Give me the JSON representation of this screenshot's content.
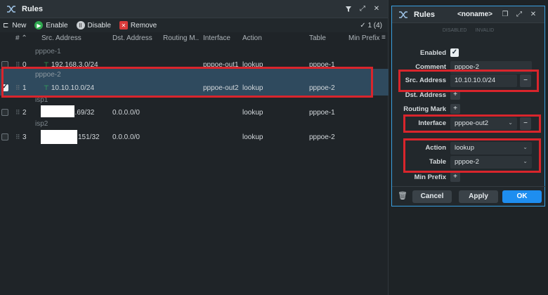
{
  "main": {
    "title": "Rules",
    "toolbar": {
      "new": "New",
      "enable": "Enable",
      "disable": "Disable",
      "remove": "Remove",
      "count": "1 (4)"
    },
    "columns": [
      "#",
      "Src. Address",
      "Dst. Address",
      "Routing M...",
      "Interface",
      "Action",
      "Table",
      "Min Prefix"
    ],
    "rows": [
      {
        "group": "pppoe-1",
        "num": "0",
        "src": "192.168.3.0/24",
        "dst": "",
        "interface": "pppoe-out1",
        "action": "lookup",
        "table": "pppoe-1",
        "selected": false
      },
      {
        "group": "pppoe-2",
        "num": "1",
        "src": "10.10.10.0/24",
        "dst": "",
        "interface": "pppoe-out2",
        "action": "lookup",
        "table": "pppoe-2",
        "selected": true
      },
      {
        "group": "isp1",
        "num": "2",
        "src": "9.69/32",
        "dst": "0.0.0.0/0",
        "interface": "",
        "action": "lookup",
        "table": "pppoe-1",
        "selected": false
      },
      {
        "group": "isp2",
        "num": "3",
        "src": "151/32",
        "dst": "0.0.0.0/0",
        "interface": "",
        "action": "lookup",
        "table": "pppoe-2",
        "selected": false
      }
    ]
  },
  "detail": {
    "title": "Rules",
    "name": "<noname>",
    "subtabs": {
      "disabled": "DISABLED",
      "invalid": "INVALID"
    },
    "labels": {
      "enabled": "Enabled",
      "comment": "Comment",
      "src": "Src. Address",
      "dst": "Dst. Address",
      "routing_mark": "Routing Mark",
      "interface": "Interface",
      "action": "Action",
      "table": "Table",
      "min_prefix": "Min Prefix"
    },
    "values": {
      "comment": "pppoe-2",
      "src": "10.10.10.0/24",
      "interface": "pppoe-out2",
      "action": "lookup",
      "table": "pppoe-2"
    },
    "buttons": {
      "cancel": "Cancel",
      "apply": "Apply",
      "ok": "OK"
    }
  }
}
